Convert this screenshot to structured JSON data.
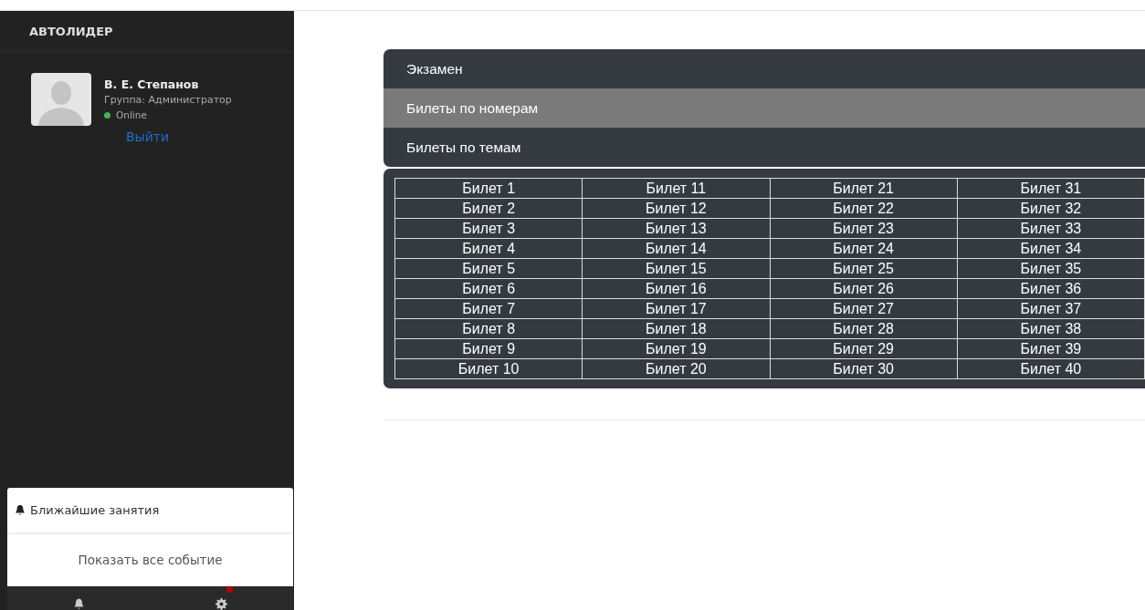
{
  "sidebar": {
    "brand": "АВТОЛИДЕР",
    "user": {
      "name": "В. Е. Степанов",
      "group": "Группа: Администратор",
      "status": "Online",
      "online": true,
      "logout": "Выйти"
    },
    "events": {
      "title": "Ближайшие занятия",
      "show_all": "Показать все событие"
    },
    "footer": [
      {
        "kind": "bell",
        "badge": false
      },
      {
        "kind": "gear",
        "badge": true
      }
    ]
  },
  "menu": [
    {
      "label": "Экзамен",
      "selected": false
    },
    {
      "label": "Билеты по номерам",
      "selected": true
    },
    {
      "label": "Билеты по темам",
      "selected": false
    }
  ],
  "tickets": {
    "rows": [
      [
        "Билет 1",
        "Билет 11",
        "Билет 21",
        "Билет 31"
      ],
      [
        "Билет 2",
        "Билет 12",
        "Билет 22",
        "Билет 32"
      ],
      [
        "Билет 3",
        "Билет 13",
        "Билет 23",
        "Билет 33"
      ],
      [
        "Билет 4",
        "Билет 14",
        "Билет 24",
        "Билет 34"
      ],
      [
        "Билет 5",
        "Билет 15",
        "Билет 25",
        "Билет 35"
      ],
      [
        "Билет 6",
        "Билет 16",
        "Билет 26",
        "Билет 36"
      ],
      [
        "Билет 7",
        "Билет 17",
        "Билет 27",
        "Билет 37"
      ],
      [
        "Билет 8",
        "Билет 18",
        "Билет 28",
        "Билет 38"
      ],
      [
        "Билет 9",
        "Билет 19",
        "Билет 29",
        "Билет 39"
      ],
      [
        "Билет 10",
        "Билет 20",
        "Билет 30",
        "Билет 40"
      ]
    ]
  }
}
